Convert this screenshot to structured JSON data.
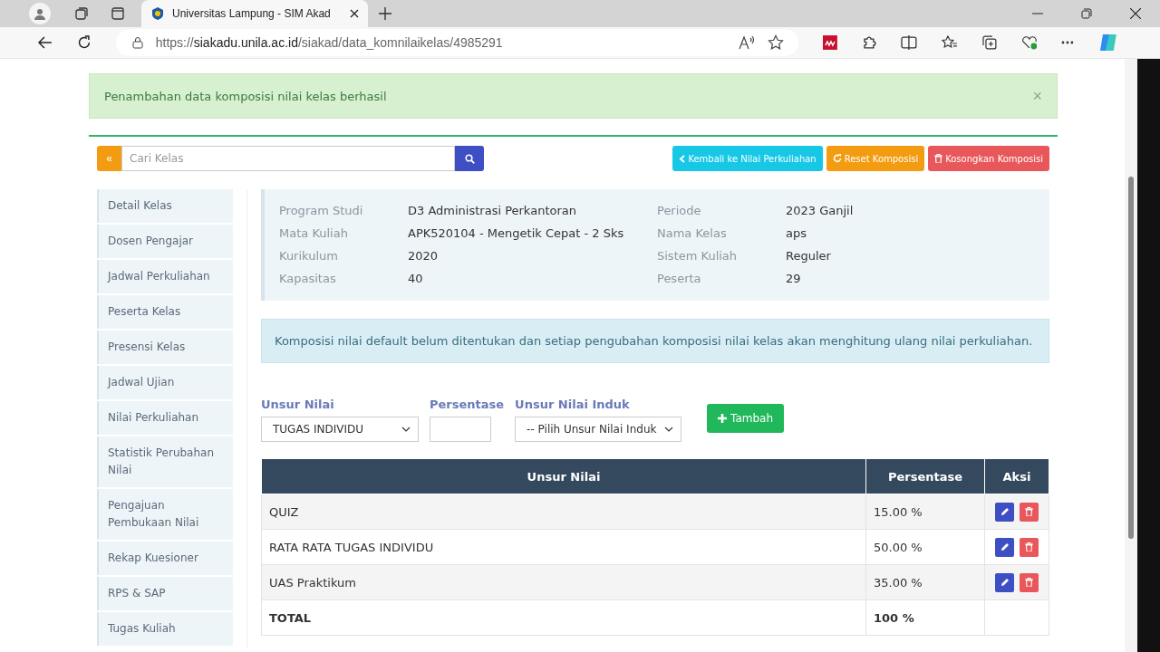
{
  "browser": {
    "tab_title": "Universitas Lampung - SIM Akad",
    "url": {
      "scheme": "https://",
      "host": "siakadu.unila.ac.id",
      "path": "/siakad/data_komnilaikelas/4985291"
    }
  },
  "alert": {
    "message": "Penambahan data komposisi nilai kelas berhasil",
    "close": "×"
  },
  "toolbar": {
    "back": "«",
    "search_placeholder": "Cari Kelas",
    "buttons": [
      {
        "label": "Kembali ke Nilai Perkuliahan",
        "kind": "back"
      },
      {
        "label": "Reset Komposisi",
        "kind": "reset"
      },
      {
        "label": "Kosongkan Komposisi",
        "kind": "clear"
      }
    ]
  },
  "sidebar": {
    "items": [
      {
        "label": "Detail Kelas",
        "selected": false
      },
      {
        "label": "Dosen Pengajar",
        "selected": false
      },
      {
        "label": "Jadwal Perkuliahan",
        "selected": false
      },
      {
        "label": "Peserta Kelas",
        "selected": false
      },
      {
        "label": "Presensi Kelas",
        "selected": false
      },
      {
        "label": "Jadwal Ujian",
        "selected": false
      },
      {
        "label": "Nilai Perkuliahan",
        "selected": false
      },
      {
        "label": "Statistik Perubahan Nilai",
        "selected": false
      },
      {
        "label": "Pengajuan Pembukaan Nilai",
        "selected": false
      },
      {
        "label": "Rekap Kuesioner",
        "selected": false
      },
      {
        "label": "RPS & SAP",
        "selected": false
      },
      {
        "label": "Tugas Kuliah",
        "selected": false
      }
    ]
  },
  "class_info": {
    "left": [
      {
        "label": "Program Studi",
        "value": "D3 Administrasi Perkantoran"
      },
      {
        "label": "Mata Kuliah",
        "value": "APK520104 - Mengetik Cepat - 2 Sks"
      },
      {
        "label": "Kurikulum",
        "value": "2020"
      },
      {
        "label": "Kapasitas",
        "value": "40"
      }
    ],
    "right": [
      {
        "label": "Periode",
        "value": "2023 Ganjil"
      },
      {
        "label": "Nama Kelas",
        "value": "aps"
      },
      {
        "label": "Sistem Kuliah",
        "value": "Reguler"
      },
      {
        "label": "Peserta",
        "value": "29"
      }
    ]
  },
  "notice": "Komposisi nilai default belum ditentukan dan setiap pengubahan komposisi nilai kelas akan menghitung ulang nilai perkuliahan.",
  "form": {
    "unsur_label": "Unsur Nilai",
    "unsur_value": "TUGAS INDIVIDU",
    "persen_label": "Persentase",
    "induk_label": "Unsur Nilai Induk",
    "induk_value": "-- Pilih Unsur Nilai Induk",
    "add_button": "Tambah"
  },
  "table": {
    "columns": [
      "Unsur Nilai",
      "Persentase",
      "Aksi"
    ],
    "rows": [
      {
        "name": "QUIZ",
        "percent": "15.00 %"
      },
      {
        "name": "RATA RATA TUGAS INDIVIDU",
        "percent": "50.00 %"
      },
      {
        "name": "UAS Praktikum",
        "percent": "35.00 %"
      }
    ],
    "total": {
      "label": "TOTAL",
      "percent": "100 %"
    }
  }
}
